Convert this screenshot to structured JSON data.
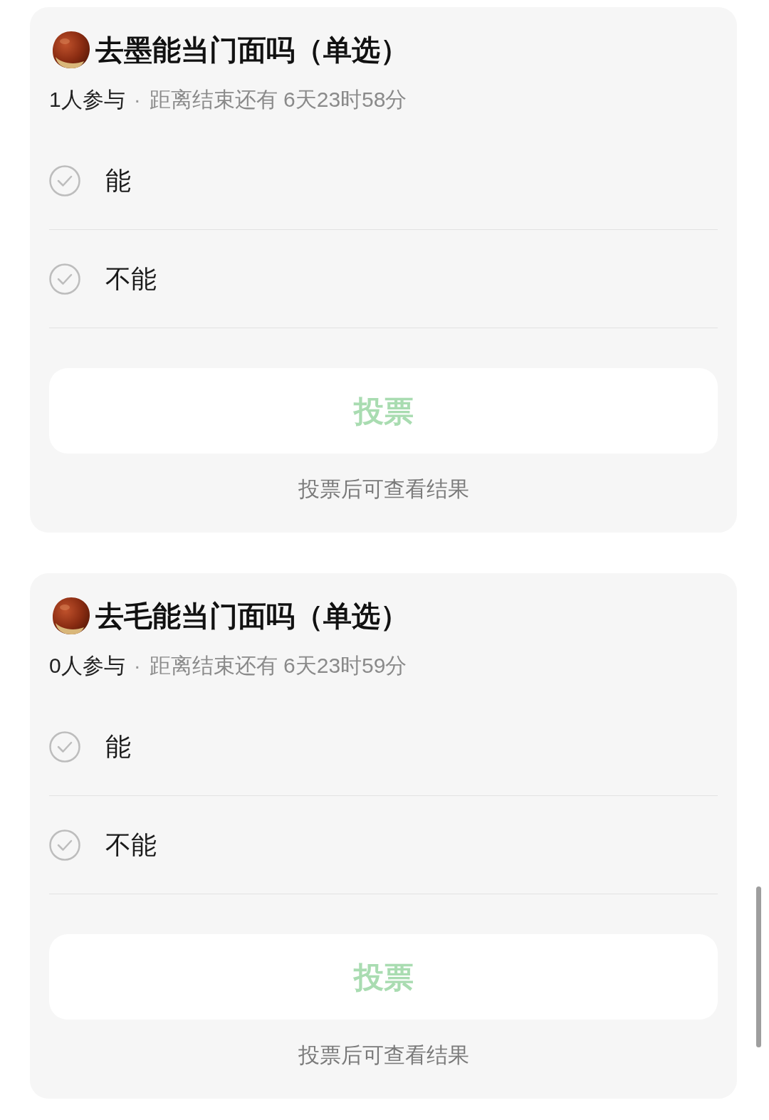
{
  "polls": [
    {
      "title": "去墨能当门面吗（单选）",
      "participants": "1人参与",
      "separator": "·",
      "countdown": "距离结束还有 6天23时58分",
      "options": [
        {
          "label": "能",
          "selected": false
        },
        {
          "label": "不能",
          "selected": false
        }
      ],
      "vote_button": {
        "label": "投票",
        "disabled": true
      },
      "footer": "投票后可查看结果"
    },
    {
      "title": "去毛能当门面吗（单选）",
      "participants": "0人参与",
      "separator": "·",
      "countdown": "距离结束还有 6天23时59分",
      "options": [
        {
          "label": "能",
          "selected": false
        },
        {
          "label": "不能",
          "selected": false
        }
      ],
      "vote_button": {
        "label": "投票",
        "disabled": true
      },
      "footer": "投票后可查看结果"
    }
  ]
}
